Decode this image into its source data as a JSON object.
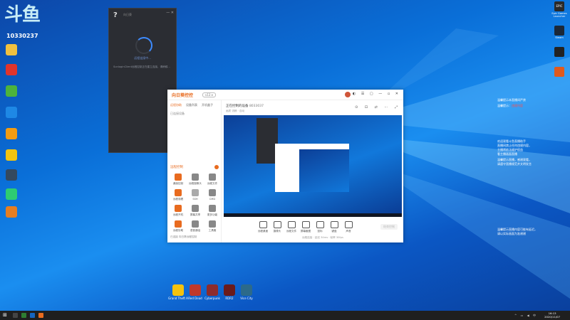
{
  "watermark": {
    "glyphs": "斗鱼",
    "room_id": "10330237"
  },
  "desktop_left_icons": [
    {
      "name": "icon-1",
      "label": "",
      "color": "#f0c040"
    },
    {
      "name": "icon-2",
      "label": "",
      "color": "#e0342c"
    },
    {
      "name": "icon-3",
      "label": "",
      "color": "#4db33d"
    },
    {
      "name": "icon-4",
      "label": "",
      "color": "#1e88e5"
    },
    {
      "name": "icon-5",
      "label": "",
      "color": "#f39c12"
    },
    {
      "name": "icon-6",
      "label": "",
      "color": "#f1c40f"
    },
    {
      "name": "icon-7",
      "label": "",
      "color": "#34495e"
    },
    {
      "name": "icon-8",
      "label": "",
      "color": "#2ecc71"
    },
    {
      "name": "icon-9",
      "label": "",
      "color": "#e67e22"
    }
  ],
  "desktop_right_icons": [
    {
      "name": "epic-games",
      "label": "Epic Games Launcher",
      "color": "#2a2a2a",
      "glyph": "EPIC"
    },
    {
      "name": "steam",
      "label": "Steam",
      "color": "#1b2838",
      "glyph": ""
    },
    {
      "name": "app-3",
      "label": "",
      "color": "#222",
      "glyph": ""
    },
    {
      "name": "app-4",
      "label": "",
      "color": "#e05a1e",
      "glyph": ""
    }
  ],
  "dark_window": {
    "help_glyph": "?",
    "title": "向日葵",
    "status": "远程连接中...",
    "text": "SunloginClient远程控制正在建立连接，请稍候..."
  },
  "app": {
    "logo": "向日葵控控",
    "version": "v13 ▾",
    "tabs": [
      "远程协助",
      "设备列表",
      "开机盒子"
    ],
    "connected": "已连接设备",
    "position_label": "远程控制",
    "tools": [
      {
        "name": "remote-desktop",
        "label": "桌面控制",
        "color": "#e86b1f"
      },
      {
        "name": "remote-camera",
        "label": "远程摄像头",
        "color": "#888"
      },
      {
        "name": "remote-file",
        "label": "远程文件",
        "color": "#888"
      },
      {
        "name": "remote-cmd",
        "label": "远程观看",
        "color": "#e86b1f"
      },
      {
        "name": "remote-ssh",
        "label": "SSH",
        "color": "#aaa"
      },
      {
        "name": "remote-cctv",
        "label": "CMD",
        "color": "#888"
      },
      {
        "name": "remote-boot",
        "label": "远程开机",
        "color": "#e86b1f"
      },
      {
        "name": "remote-share",
        "label": "屏幕共享",
        "color": "#888"
      },
      {
        "name": "remote-more",
        "label": "更多功能",
        "color": "#888"
      },
      {
        "name": "remote-help",
        "label": "远程协助",
        "color": "#e86b1f"
      },
      {
        "name": "remote-mic",
        "label": "语音通话",
        "color": "#888"
      },
      {
        "name": "remote-tools",
        "label": "工具箱",
        "color": "#888"
      }
    ],
    "footer": "已连接 向日葵远程控制",
    "host_label": "正在控制的设备",
    "host_id": "8033037",
    "quality": "画质 流畅 · 自动",
    "controls": [
      "远程桌面",
      "摄像头",
      "远程文件",
      "屏幕截图",
      "鼠标",
      "键盘",
      "声音"
    ],
    "end_label": "结束控制",
    "status": "远程连接 · 延迟 34ms · 帧率 30fps"
  },
  "notes": [
    {
      "text": "温馨提示本直播间严禁",
      "highlight": ""
    },
    {
      "text": "温馨提示：",
      "highlight": "违规内容"
    },
    {
      "text": "欢迎观看斗鱼直播助手",
      "highlight": ""
    },
    {
      "text": "直播间禁止任何违规内容，",
      "highlight": ""
    },
    {
      "text": "主播将依法维护权益",
      "highlight": ""
    },
    {
      "text": "看主播画面直播",
      "highlight": ""
    },
    {
      "text": "温馨提示直播，感谢观看，",
      "highlight": ""
    },
    {
      "text": "请遵守直播规范并文明发言",
      "highlight": ""
    },
    {
      "text": "温馨提示直播内容可能有延迟，",
      "highlight": ""
    },
    {
      "text": "请以实际画面为准谢谢",
      "highlight": ""
    }
  ],
  "games": [
    {
      "name": "game-rockstar",
      "label": "Grand Theft Auto V",
      "color": "#f4c20d"
    },
    {
      "name": "game-red",
      "label": "Red Dead",
      "color": "#c0392b"
    },
    {
      "name": "game-cp",
      "label": "Cyberpunk",
      "color": "#8e2c2c"
    },
    {
      "name": "game-rdr",
      "label": "RDR2",
      "color": "#6b1b1b"
    },
    {
      "name": "game-vice",
      "label": "Vice City",
      "color": "#2c6a8a"
    }
  ],
  "taskbar": {
    "win_glyph": "⊞",
    "clock_time": "16:13",
    "clock_date": "2020/11/07",
    "tray": "^ ▭ ◀ 中"
  },
  "colors": {
    "accent": "#e86b1f",
    "desktop": "#0a6fd8"
  }
}
